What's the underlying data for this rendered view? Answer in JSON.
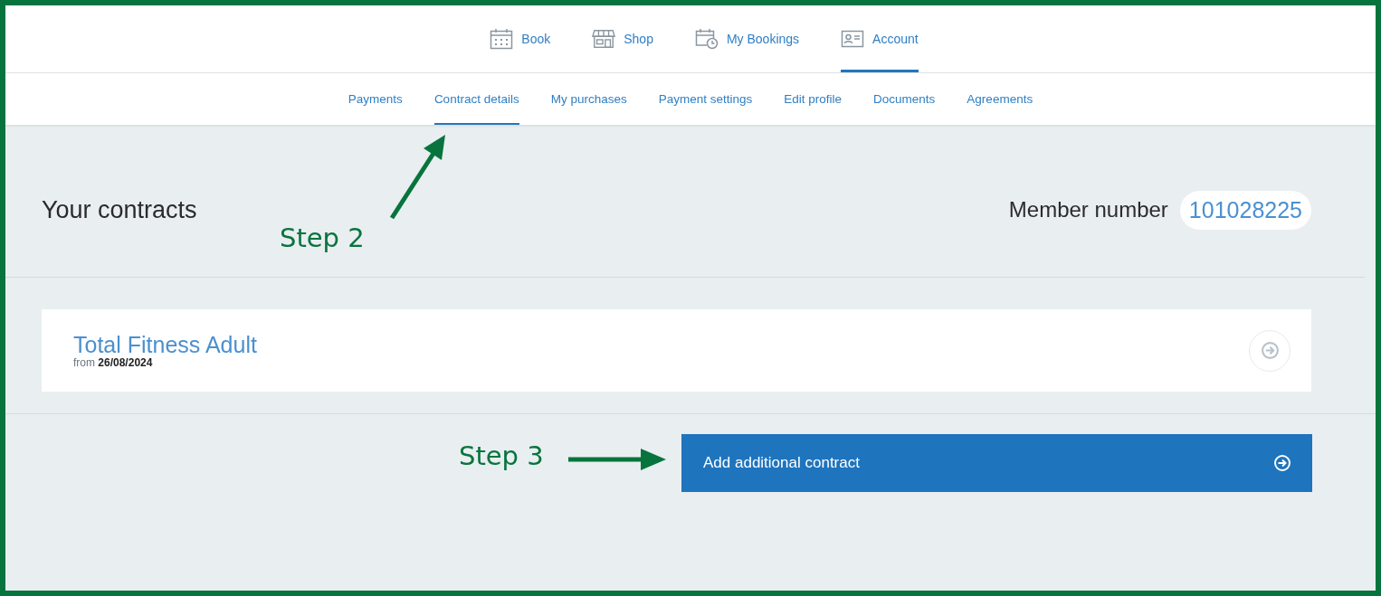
{
  "top_nav": [
    {
      "label": "Book",
      "kind": "calendar",
      "selected": false
    },
    {
      "label": "Shop",
      "kind": "store",
      "selected": false
    },
    {
      "label": "My Bookings",
      "kind": "schedule",
      "selected": false
    },
    {
      "label": "Account",
      "kind": "idcard",
      "selected": true
    }
  ],
  "sub_nav": [
    {
      "label": "Payments",
      "selected": false
    },
    {
      "label": "Contract details",
      "selected": true
    },
    {
      "label": "My purchases",
      "selected": false
    },
    {
      "label": "Payment settings",
      "selected": false
    },
    {
      "label": "Edit profile",
      "selected": false
    },
    {
      "label": "Documents",
      "selected": false
    },
    {
      "label": "Agreements",
      "selected": false
    }
  ],
  "heading": "Your contracts",
  "member": {
    "label": "Member number",
    "value": "101028225"
  },
  "contracts": [
    {
      "name": "Total Fitness Adult",
      "from_label": "from",
      "from_date": "26/08/2024"
    }
  ],
  "add_button": {
    "label": "Add additional contract"
  },
  "annotations": [
    {
      "label": "Step 2",
      "kind": "diagonal"
    },
    {
      "label": "Step 3",
      "kind": "horizontal"
    }
  ]
}
